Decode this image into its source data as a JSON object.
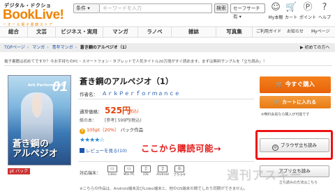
{
  "header": {
    "logo_top": "デジタル・ドクショ",
    "logo_main": "BookLive",
    "logo_mark": "!",
    "logo_sub": "ー オ ー ル 電 子 書 籍 ス ト ア",
    "cond_label": "条件 ▾",
    "search_placeholder": "キーワードを入力",
    "search_button": "検索",
    "safe_search": "セーフサーチ 有 ▾",
    "icons": [
      {
        "name": "mypage-icon",
        "glyph": "☺",
        "label": "My本棚"
      },
      {
        "name": "cart-icon",
        "glyph": "🛒",
        "label": "カート"
      },
      {
        "name": "point-icon",
        "glyph": "Ⓟ",
        "label": "ポイント"
      },
      {
        "name": "help-icon",
        "glyph": "?",
        "label": "ヘルプ"
      }
    ]
  },
  "nav": {
    "items": [
      "総合",
      "文芸",
      "ビジネス・実用",
      "マンガ",
      "ラノベ",
      "雑誌",
      "写真集"
    ],
    "right": [
      "ご利用ガイド",
      "お知らせ",
      "Myページ"
    ]
  },
  "breadcrumb": {
    "items": [
      "TOPページ",
      "マンガ",
      "青年マンガ"
    ],
    "current": "蒼き鋼のアルペジオ（1）",
    "first_time": "初めての方へ"
  },
  "notice": {
    "text": "電子書籍は初めてですか？今お手持ちのPC・スマートフォン・タブレットで人気タイトル20万冊がすぐ読めます。まずは無料サンプルを「立ち読み」！"
  },
  "cover": {
    "brand": "Ark Performance",
    "vol": "01",
    "title_art": "蒼き鋼の\nアルペジオ",
    "badge": "pt バック"
  },
  "book": {
    "title": "蒼き鋼のアルペジオ（1）",
    "author_label": "作者名：",
    "author": "ＡｒｋＰｅｒｆｏｒｍａｎｃｅ",
    "price_label": "通常価格：",
    "price": "525円",
    "tax": "(税込)",
    "paper_label": "紙の本：",
    "paper": "[参考] 599円(税込)",
    "point_ico": "P",
    "point_value": "105pt（20%）",
    "point_suffix": "バック作品",
    "rating": 3.5,
    "stars": "★★★★☆",
    "review": "レビューを見る(10)",
    "devices_label": "対応端末：",
    "devices": [
      {
        "name": "reader-device-icon",
        "label": "Lideo"
      },
      {
        "name": "winpc-device-icon",
        "label": "Win PC"
      },
      {
        "name": "ios-device-icon",
        "label": "iOS"
      },
      {
        "name": "android-device-icon",
        "label": "Android"
      },
      {
        "name": "browser-device-icon",
        "label": "ブラウザ"
      }
    ],
    "footnote": "※こちらの作品は、Android端末及びLideo端末と、他のOS端末の間でしおり同期ができません。"
  },
  "callout": "ここから購読可能→",
  "actions": {
    "buy_now": "🛒 今すぐ購入",
    "cart": "🛒 カートに入れる",
    "cart_note": "※無料会員なら購入が可能です",
    "browser_read": "ブラウザ立ち読み",
    "browser_glyph": "◎",
    "app_read": "アプリ立ち読み",
    "read_how": "立ち読みの方法はこちら"
  },
  "watermark": "週刊アスキー",
  "colors": {
    "brand_orange": "#f08300",
    "price_red": "#e4420a",
    "callout_red": "#e41c1c",
    "link_blue": "#1a56b0"
  }
}
